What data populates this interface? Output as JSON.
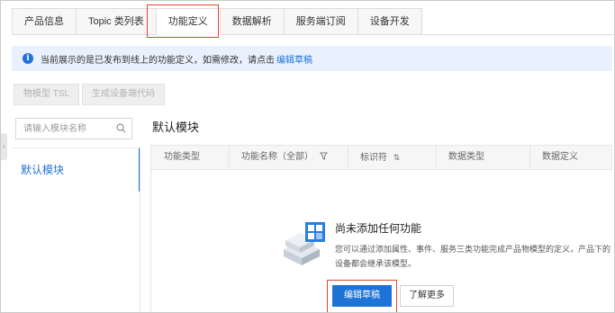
{
  "tabs": [
    {
      "label": "产品信息"
    },
    {
      "label": "Topic 类列表"
    },
    {
      "label": "功能定义"
    },
    {
      "label": "数据解析"
    },
    {
      "label": "服务端订阅"
    },
    {
      "label": "设备开发"
    }
  ],
  "active_tab": "功能定义",
  "info": {
    "icon": "info-icon",
    "text": "当前展示的是已发布到线上的功能定义，如需修改，请点击",
    "link": "编辑草稿"
  },
  "toolbar": {
    "tsl_button": "物模型 TSL",
    "gen_code_button": "生成设备端代码"
  },
  "sidebar": {
    "search_placeholder": "请输入模块名称",
    "modules": [
      {
        "label": "默认模块"
      }
    ]
  },
  "main": {
    "module_title": "默认模块",
    "columns": [
      "功能类型",
      "功能名称（全部）",
      "标识符",
      "数据类型",
      "数据定义"
    ]
  },
  "empty_state": {
    "title": "尚未添加任何功能",
    "description": "您可以通过添加属性、事件、服务三类功能完成产品物模型的定义，产品下的设备都会继承该模型。",
    "primary_button": "编辑草稿",
    "secondary_button": "了解更多"
  },
  "colors": {
    "accent": "#1f73d6",
    "highlight": "#e0453a",
    "info_bg": "#e8f1fd"
  }
}
